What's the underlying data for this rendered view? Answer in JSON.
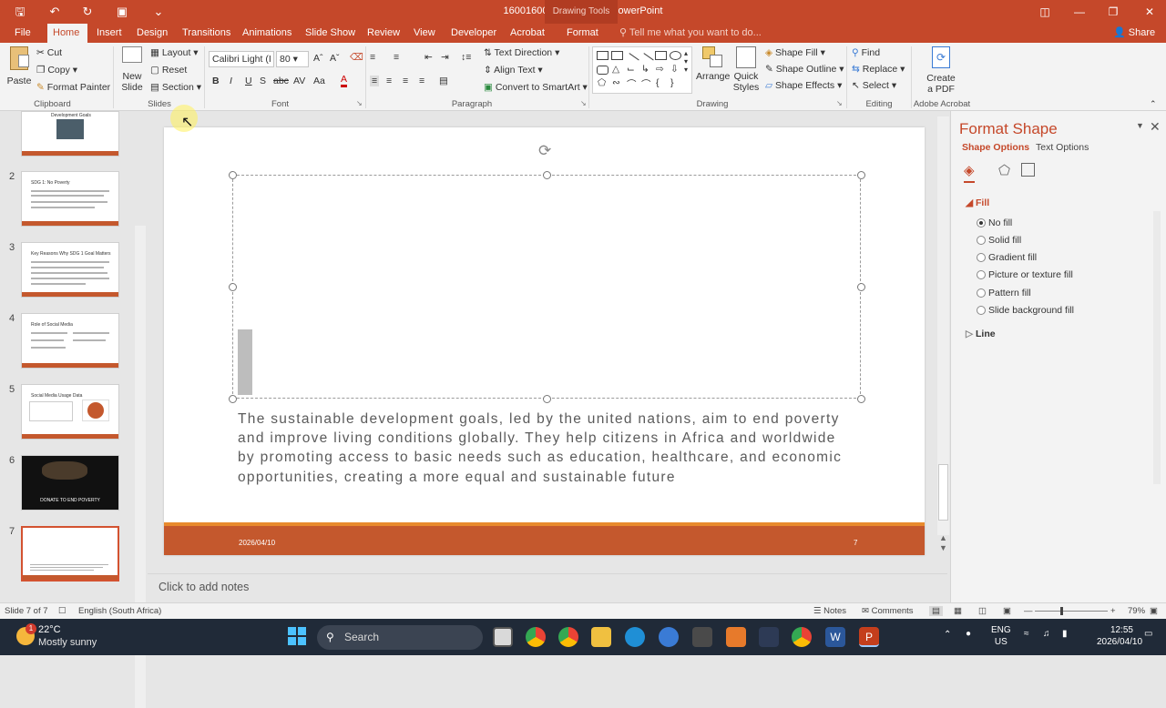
{
  "window": {
    "title": "16001600_KhaliSDGs - PowerPoint",
    "context_tab": "Drawing Tools"
  },
  "tabs": [
    "File",
    "Home",
    "Insert",
    "Design",
    "Transitions",
    "Animations",
    "Slide Show",
    "Review",
    "View",
    "Developer",
    "Acrobat",
    "Format"
  ],
  "active_tab": "Home",
  "tell_me": "Tell me what you want to do...",
  "share": "Share",
  "ribbon": {
    "clipboard": {
      "paste": "Paste",
      "cut": "Cut",
      "copy": "Copy",
      "format_painter": "Format Painter",
      "group": "Clipboard"
    },
    "slides": {
      "new_slide": "New",
      "new_slide2": "Slide",
      "layout": "Layout",
      "reset": "Reset",
      "section": "Section",
      "group": "Slides"
    },
    "font": {
      "family": "Calibri Light (I",
      "size": "80",
      "group": "Font"
    },
    "paragraph": {
      "text_direction": "Text Direction",
      "align_text": "Align Text",
      "convert": "Convert to SmartArt",
      "group": "Paragraph"
    },
    "drawing": {
      "arrange": "Arrange",
      "quick_styles": "Quick",
      "quick_styles2": "Styles",
      "shape_fill": "Shape Fill",
      "shape_outline": "Shape Outline",
      "shape_effects": "Shape Effects",
      "group": "Drawing"
    },
    "editing": {
      "find": "Find",
      "replace": "Replace",
      "select": "Select",
      "group": "Editing"
    },
    "acrobat": {
      "create": "Create",
      "create2": "a PDF",
      "group": "Adobe Acrobat"
    }
  },
  "thumbnails": [
    {
      "num": "",
      "title": "Development Goals"
    },
    {
      "num": "2",
      "title": "SDG 1: No Poverty"
    },
    {
      "num": "3",
      "title": "Key Reasons Why SDG 1 Goal Matters"
    },
    {
      "num": "4",
      "title": "Role of Social Media"
    },
    {
      "num": "5",
      "title": "Social Media Usage Data"
    },
    {
      "num": "6",
      "title": "DONATE TO END POVERTY"
    },
    {
      "num": "7",
      "title": ""
    }
  ],
  "slide": {
    "body": "The sustainable development goals, led by the united nations, aim to end poverty and improve living conditions globally. They help citizens in Africa and worldwide by promoting access to basic needs such as education, healthcare, and economic opportunities, creating a more equal and sustainable future",
    "date": "2026/04/10",
    "number": "7"
  },
  "notes_placeholder": "Click to add notes",
  "format_pane": {
    "title": "Format Shape",
    "tab_shape": "Shape Options",
    "tab_text": "Text Options",
    "fill_header": "Fill",
    "fill_options": [
      "No fill",
      "Solid fill",
      "Gradient fill",
      "Picture or texture fill",
      "Pattern fill",
      "Slide background fill"
    ],
    "selected_fill": "No fill",
    "line_header": "Line"
  },
  "status": {
    "slide": "Slide 7 of 7",
    "language": "English (South Africa)",
    "notes": "Notes",
    "comments": "Comments",
    "zoom": "79%"
  },
  "taskbar": {
    "temp": "22°C",
    "condition": "Mostly sunny",
    "search": "Search",
    "lang": "ENG",
    "region": "US",
    "time": "12:55",
    "date": "2026/04/10"
  },
  "colors": {
    "accent": "#c5482a",
    "slide_band": "#c4582d",
    "strip": "#e88a2d"
  }
}
